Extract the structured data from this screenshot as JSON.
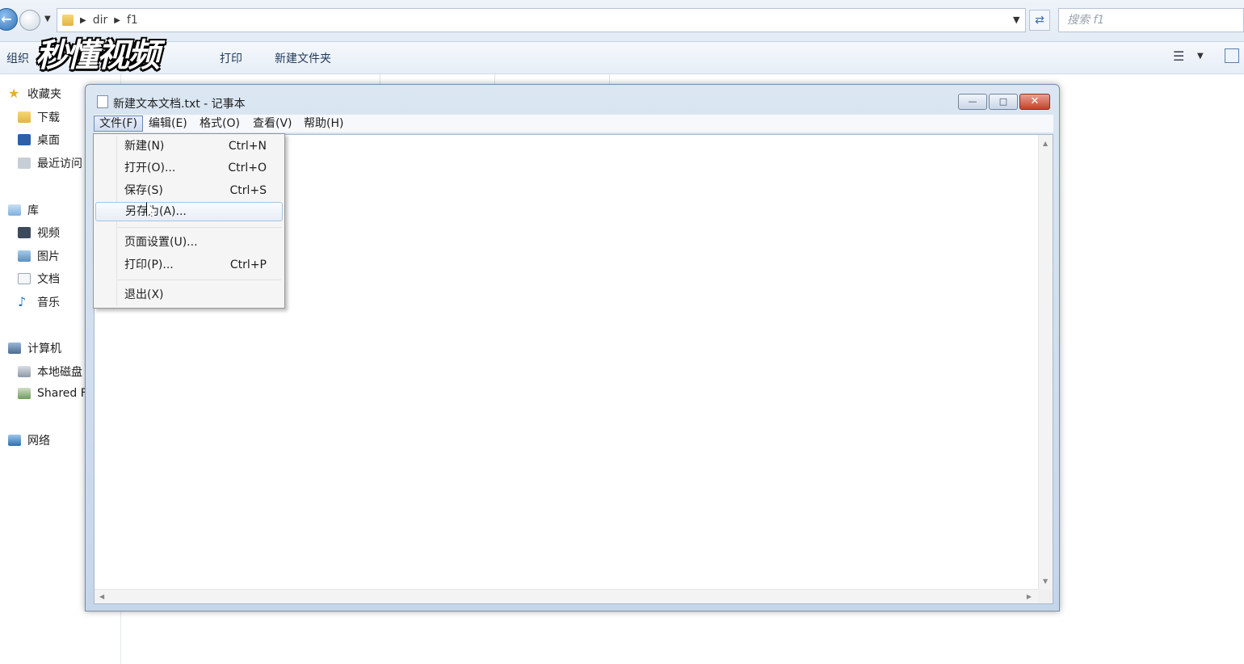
{
  "explorer": {
    "breadcrumb": [
      "dir",
      "f1"
    ],
    "search_placeholder": "搜索 f1",
    "toolbar": {
      "organize": "组织",
      "print": "打印",
      "new_folder": "新建文件夹"
    },
    "sidebar": {
      "favorites": "收藏夹",
      "downloads": "下载",
      "desktop": "桌面",
      "recent": "最近访问",
      "library": "库",
      "videos": "视频",
      "pictures": "图片",
      "documents": "文档",
      "music": "音乐",
      "computer": "计算机",
      "local_disk": "本地磁盘",
      "shared": "Shared F",
      "network": "网络"
    }
  },
  "watermark": "秒懂视频",
  "notepad": {
    "title": "新建文本文档.txt - 记事本",
    "menu": [
      "文件(F)",
      "编辑(E)",
      "格式(O)",
      "查看(V)",
      "帮助(H)"
    ],
    "file_menu": [
      {
        "label": "新建(N)",
        "shortcut": "Ctrl+N"
      },
      {
        "label": "打开(O)...",
        "shortcut": "Ctrl+O"
      },
      {
        "label": "保存(S)",
        "shortcut": "Ctrl+S"
      },
      {
        "label": "另存为(A)...",
        "shortcut": ""
      },
      {
        "label": "页面设置(U)...",
        "shortcut": ""
      },
      {
        "label": "打印(P)...",
        "shortcut": "Ctrl+P"
      },
      {
        "label": "退出(X)",
        "shortcut": ""
      }
    ],
    "hovered_item": "另存为(A)..."
  },
  "colors": {
    "accent": "#2f6fb7",
    "close_button": "#c4412a",
    "menu_highlight": "#a8c3e4"
  }
}
